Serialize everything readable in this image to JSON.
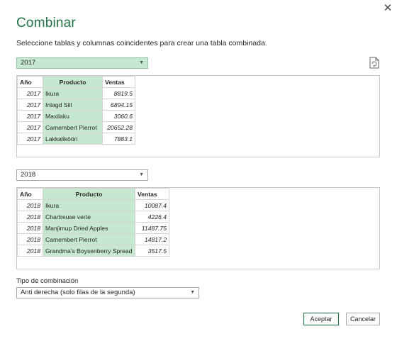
{
  "dialog": {
    "title": "Combinar",
    "subtitle": "Seleccione tablas y columnas coincidentes para crear una tabla combinada.",
    "close_glyph": "✕"
  },
  "table1": {
    "dropdown_value": "2017",
    "headers": [
      "Año",
      "Producto",
      "Ventas"
    ],
    "selected_column": "Producto",
    "rows": [
      [
        "2017",
        "Ikura",
        "8819.5"
      ],
      [
        "2017",
        "Inlagd Sill",
        "6894.15"
      ],
      [
        "2017",
        "Maxilaku",
        "3060.6"
      ],
      [
        "2017",
        "Camembert Pierrot",
        "20652.28"
      ],
      [
        "2017",
        "Lakkalikööri",
        "7883.1"
      ]
    ]
  },
  "table2": {
    "dropdown_value": "2018",
    "headers": [
      "Año",
      "Producto",
      "Ventas"
    ],
    "selected_column": "Producto",
    "rows": [
      [
        "2018",
        "Ikura",
        "10087.4"
      ],
      [
        "2018",
        "Chartreuse verte",
        "4226.4"
      ],
      [
        "2018",
        "Manjimup Dried Apples",
        "11487.75"
      ],
      [
        "2018",
        "Camembert Pierrot",
        "14817.2"
      ],
      [
        "2018",
        "Grandma's Boysenberry Spread",
        "3517.5"
      ]
    ]
  },
  "join": {
    "label": "Tipo de combinación",
    "value": "Anti derecha (solo filas de la segunda)"
  },
  "buttons": {
    "ok": "Aceptar",
    "cancel": "Cancelar"
  },
  "icons": {
    "close": "close-icon",
    "dropdown": "chevron-down-icon",
    "file": "file-icon"
  },
  "colors": {
    "accent": "#217346",
    "selection": "#c6e7d0"
  }
}
